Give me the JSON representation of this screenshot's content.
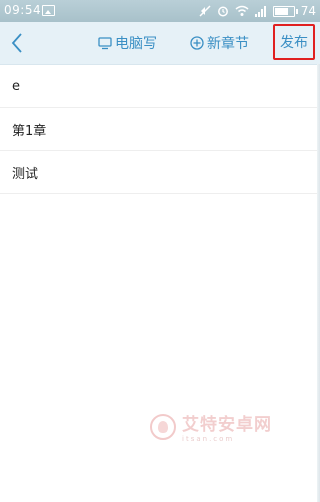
{
  "status_bar": {
    "time": "09:54",
    "battery": "74",
    "battery_level": 0.74,
    "icons": [
      "image-icon",
      "mute-icon",
      "alarm-icon",
      "wifi-icon",
      "signal-icon",
      "battery-icon"
    ]
  },
  "appbar": {
    "back_icon": "chevron-left-icon",
    "pc_write_label": "电脑写",
    "pc_write_icon": "monitor-icon",
    "new_chapter_label": "新章节",
    "new_chapter_icon": "plus-circle-icon",
    "publish_label": "发布",
    "accent_color": "#3a8fc4",
    "highlight_color": "#e02020"
  },
  "chapters": [
    {
      "title": "e"
    },
    {
      "title": "第1章"
    },
    {
      "title": "测试"
    }
  ],
  "watermark": {
    "title": "艾特安卓网",
    "subtitle": "itsan.com"
  }
}
